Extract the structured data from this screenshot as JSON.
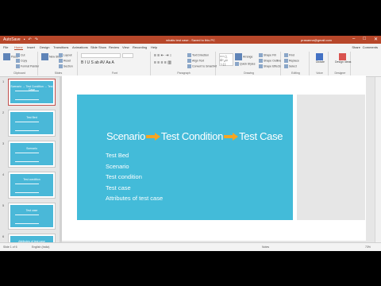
{
  "window": {
    "title": "whatis test case - Saved to this PC",
    "autosave": "AutoSave",
    "user": "prasanna@gmail.com",
    "controls": [
      "–",
      "□",
      "✕"
    ]
  },
  "tabs": [
    "File",
    "Home",
    "Insert",
    "Design",
    "Transitions",
    "Animations",
    "Slide Show",
    "Review",
    "View",
    "Recording",
    "Help"
  ],
  "active_tab": "Home",
  "share_label": "Share",
  "comments_label": "Comments",
  "ribbon": {
    "clipboard": {
      "label": "Clipboard",
      "paste": "Paste",
      "cut": "Cut",
      "copy": "Copy",
      "format_painter": "Format Painter"
    },
    "slides": {
      "label": "Slides",
      "new_slide": "New Slide",
      "layout": "Layout",
      "reset": "Reset",
      "section": "Section"
    },
    "font": {
      "label": "Font"
    },
    "paragraph": {
      "label": "Paragraph",
      "text_direction": "Text Direction",
      "align_text": "Align Text",
      "smartart": "Convert to SmartArt"
    },
    "drawing": {
      "label": "Drawing",
      "shape_fill": "Shape Fill",
      "shape_outline": "Shape Outline",
      "shape_effects": "Shape Effects",
      "arrange": "Arrange",
      "quick_styles": "Quick Styles"
    },
    "editing": {
      "label": "Editing",
      "find": "Find",
      "replace": "Replace",
      "select": "Select"
    },
    "voice": {
      "label": "Voice",
      "dictate": "Dictate"
    },
    "designer": {
      "label": "Designer",
      "design_ideas": "Design Ideas"
    }
  },
  "thumbnails": [
    {
      "num": "1",
      "title": "Scenario → Test Condition → Test Case"
    },
    {
      "num": "2",
      "title": "Test Bed"
    },
    {
      "num": "3",
      "title": "Scenario"
    },
    {
      "num": "4",
      "title": "Test condition"
    },
    {
      "num": "5",
      "title": "Test case"
    },
    {
      "num": "6",
      "title": "Attributes of test case"
    }
  ],
  "slide": {
    "headline_part1": "Scenario",
    "headline_part2": "Test Condition",
    "headline_part3": "Test Case",
    "bullets": [
      "Test Bed",
      "Scenario",
      "Test condition",
      "Test case",
      "Attributes of test case"
    ]
  },
  "status": {
    "slide_info": "Slide 1 of 6",
    "language": "English (India)",
    "notes": "Notes",
    "zoom": "73%"
  },
  "colors": {
    "accent": "#b7472a",
    "slide_bg": "#43bbd9",
    "arrow": "#f5a623"
  }
}
